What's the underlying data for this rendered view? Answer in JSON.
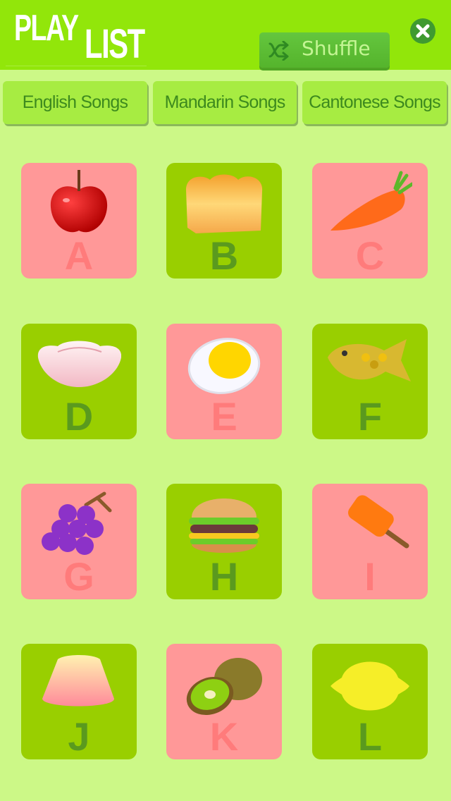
{
  "header": {
    "logo_top": "PLAY",
    "logo_bottom": "LIST",
    "shuffle_label": "Shuffle",
    "shuffle_icon": "shuffle-icon",
    "close_icon": "close-icon"
  },
  "tabs": [
    {
      "label": "English Songs"
    },
    {
      "label": "Mandarin Songs"
    },
    {
      "label": "Cantonese Songs"
    }
  ],
  "colors": {
    "header_bg": "#92e60a",
    "page_bg": "#ccf887",
    "card_pink": "#ff9898",
    "card_green": "#99cf00"
  },
  "cards": [
    {
      "letter": "A",
      "item": "apple",
      "style": "pink"
    },
    {
      "letter": "B",
      "item": "bread",
      "style": "green"
    },
    {
      "letter": "C",
      "item": "carrot",
      "style": "pink"
    },
    {
      "letter": "D",
      "item": "dumpling",
      "style": "green"
    },
    {
      "letter": "E",
      "item": "egg",
      "style": "pink"
    },
    {
      "letter": "F",
      "item": "fish",
      "style": "green"
    },
    {
      "letter": "G",
      "item": "grapes",
      "style": "pink"
    },
    {
      "letter": "H",
      "item": "hamburger",
      "style": "green"
    },
    {
      "letter": "I",
      "item": "ice-pop",
      "style": "pink"
    },
    {
      "letter": "J",
      "item": "jelly",
      "style": "green"
    },
    {
      "letter": "K",
      "item": "kiwi",
      "style": "pink"
    },
    {
      "letter": "L",
      "item": "lemon",
      "style": "green"
    }
  ]
}
